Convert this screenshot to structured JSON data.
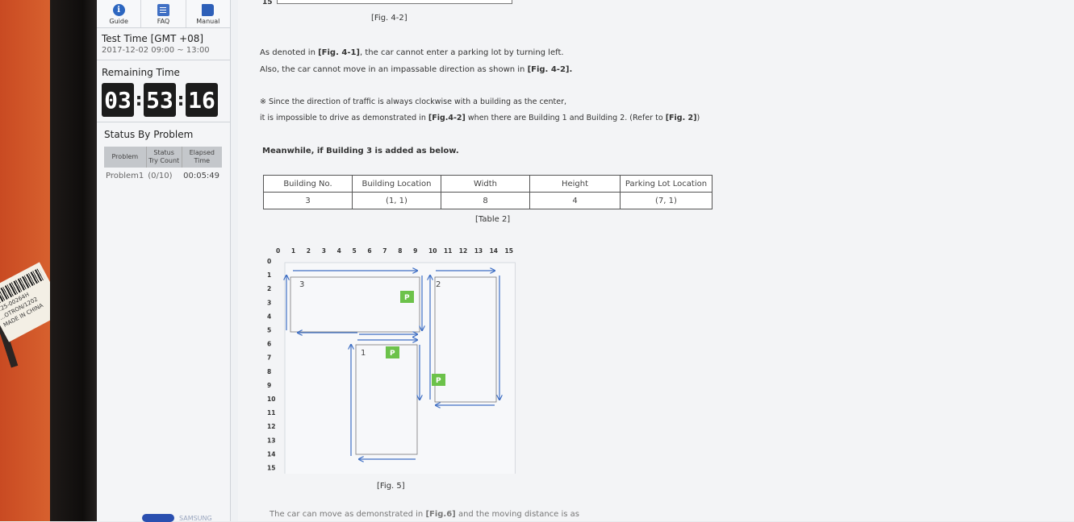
{
  "sidebar": {
    "tools": [
      {
        "label": "Guide",
        "icon": "info-icon"
      },
      {
        "label": "FAQ",
        "icon": "document-icon"
      },
      {
        "label": "Manual",
        "icon": "book-icon"
      }
    ],
    "test_time_label": "Test Time [GMT +08]",
    "test_time_value": "2017-12-02 09:00 ~ 13:00",
    "remaining_label": "Remaining Time",
    "timer": {
      "hours": "03",
      "minutes": "53",
      "seconds": "16"
    },
    "status_label": "Status By Problem",
    "status_headers": {
      "problem": "Problem",
      "status_line1": "Status",
      "status_line2": "Try Count",
      "elapsed_line1": "Elapsed",
      "elapsed_line2": "Time"
    },
    "problem_row": {
      "name": "Problem1",
      "tries": "(0/10)",
      "elapsed": "00:05:49"
    },
    "brand_text": "SAMSUNG"
  },
  "content": {
    "top_number": "15",
    "fig42_caption": "[Fig. 4-2]",
    "para1_pre": "As denoted in ",
    "para1_ref": "[Fig. 4-1]",
    "para1_post": ", the car cannot enter a parking lot by turning left.",
    "para2_pre": "Also, the car cannot move in an impassable direction as shown in ",
    "para2_ref": "[Fig. 4-2].",
    "note1": "※ Since the direction of traffic is always clockwise with a building as the center,",
    "note2_pre": "it is impossible to drive as demonstrated in ",
    "note2_ref": "[Fig.4-2]",
    "note2_mid": " when there are Building 1 and Building 2. (Refer to ",
    "note2_ref2": "[Fig. 2]",
    "note2_post": ")",
    "meanwhile": "Meanwhile, if Building 3 is added as below.",
    "table": {
      "headers": [
        "Building No.",
        "Building Location",
        "Width",
        "Height",
        "Parking Lot Location"
      ],
      "row": [
        "3",
        "(1, 1)",
        "8",
        "4",
        "(7, 1)"
      ]
    },
    "table_caption": "[Table 2]",
    "fig5": {
      "axis_ticks": [
        "0",
        "1",
        "2",
        "3",
        "4",
        "5",
        "6",
        "7",
        "8",
        "9",
        "10",
        "11",
        "12",
        "13",
        "14",
        "15"
      ],
      "building_labels": [
        "3",
        "2",
        "1"
      ],
      "parking_label": "P"
    },
    "fig5_caption": "[Fig. 5]",
    "bottom_line_pre": "The car can move as demonstrated in ",
    "bottom_line_ref": "[Fig.6]",
    "bottom_line_post": " and the moving distance is as"
  }
}
